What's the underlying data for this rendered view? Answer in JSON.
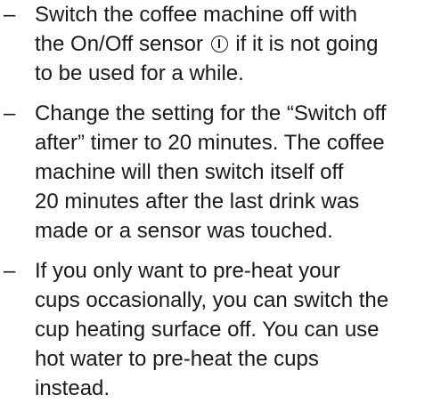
{
  "items": [
    {
      "dash": "–",
      "lines": [
        "Switch the coffee machine off with",
        "the On/Off sensor",
        "if it is not going",
        "to be used for a while."
      ],
      "icon": "power-icon"
    },
    {
      "dash": "–",
      "lines": [
        "Change the setting for the “Switch off",
        "after” timer to 20 minutes. The coffee",
        "machine will then switch itself off",
        "20 minutes after the last drink was",
        "made or a sensor was touched."
      ]
    },
    {
      "dash": "–",
      "lines": [
        "If you only want to pre-heat your",
        "cups occasionally, you can switch the",
        "cup heating surface off. You can use",
        "hot water to pre-heat the cups",
        "instead."
      ]
    }
  ]
}
